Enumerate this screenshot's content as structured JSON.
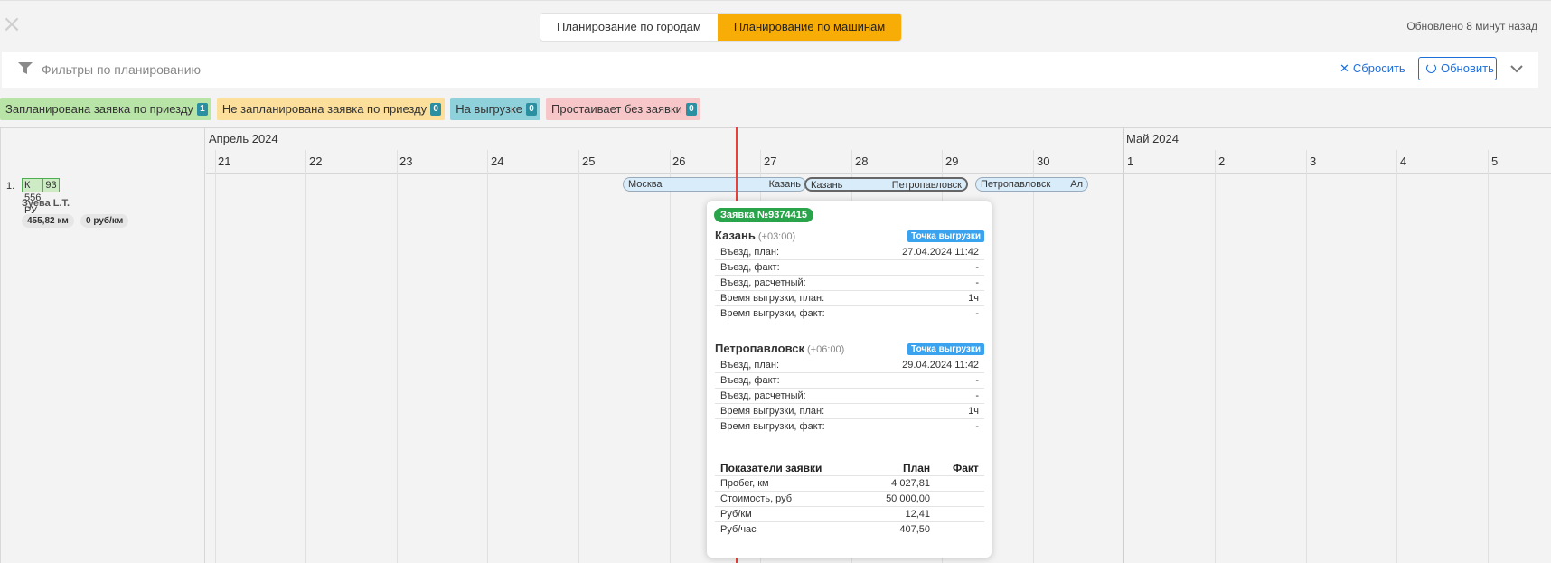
{
  "header": {
    "tabs": [
      "Планирование по городам",
      "Планирование по машинам"
    ],
    "active_tab_index": 1,
    "updated": "Обновлено 8 минут назад",
    "close_icon": "close-icon"
  },
  "filters": {
    "placeholder": "Фильтры по планированию",
    "reset_label": "Сбросить",
    "refresh_label": "Обновить"
  },
  "legend": [
    {
      "label": "Запланирована заявка по приезду",
      "count": "1",
      "color": "#b9e4a8"
    },
    {
      "label": "Не запланирована заявка по приезду",
      "count": "0",
      "color": "#fbdf9a"
    },
    {
      "label": "На выгрузке",
      "count": "0",
      "color": "#8fd1db"
    },
    {
      "label": "Простаивает без заявки",
      "count": "0",
      "color": "#f6c6c8"
    }
  ],
  "timeline": {
    "months": [
      "Апрель 2024",
      "Май 2024"
    ],
    "days": [
      "21",
      "22",
      "23",
      "24",
      "25",
      "26",
      "27",
      "28",
      "29",
      "30",
      "1",
      "2",
      "3",
      "4",
      "5"
    ]
  },
  "vehicle": {
    "index": "1.",
    "plate": "К 556 РУ",
    "region": "93",
    "driver": "Зуева L.T.",
    "distance": "455,82 км",
    "rate": "0 руб/км"
  },
  "routes": [
    {
      "from": "Москва",
      "to": "Казань"
    },
    {
      "from": "Казань",
      "to": "Петропавловск"
    },
    {
      "from": "Петропавловск",
      "to": "Ал"
    }
  ],
  "tooltip": {
    "title": "Заявка №9374415",
    "stops": [
      {
        "city": "Казань",
        "tz": "(+03:00)",
        "badge": "Точка выгрузки",
        "rows": [
          {
            "k": "Въезд, план:",
            "v": "27.04.2024 11:42"
          },
          {
            "k": "Въезд, факт:",
            "v": "-"
          },
          {
            "k": "Въезд, расчетный:",
            "v": "-"
          },
          {
            "k": "Время выгрузки, план:",
            "v": "1ч"
          },
          {
            "k": "Время выгрузки, факт:",
            "v": "-"
          }
        ]
      },
      {
        "city": "Петропавловск",
        "tz": "(+06:00)",
        "badge": "Точка выгрузки",
        "rows": [
          {
            "k": "Въезд, план:",
            "v": "29.04.2024 11:42"
          },
          {
            "k": "Въезд, факт:",
            "v": "-"
          },
          {
            "k": "Въезд, расчетный:",
            "v": "-"
          },
          {
            "k": "Время выгрузки, план:",
            "v": "1ч"
          },
          {
            "k": "Время выгрузки, факт:",
            "v": "-"
          }
        ]
      }
    ],
    "metrics_headers": [
      "Показатели заявки",
      "План",
      "Факт"
    ],
    "metrics": [
      {
        "k": "Пробег, км",
        "plan": "4 027,81"
      },
      {
        "k": "Стоимость, руб",
        "plan": "50 000,00"
      },
      {
        "k": "Руб/км",
        "plan": "12,41"
      },
      {
        "k": "Руб/час",
        "plan": "407,50"
      }
    ]
  }
}
